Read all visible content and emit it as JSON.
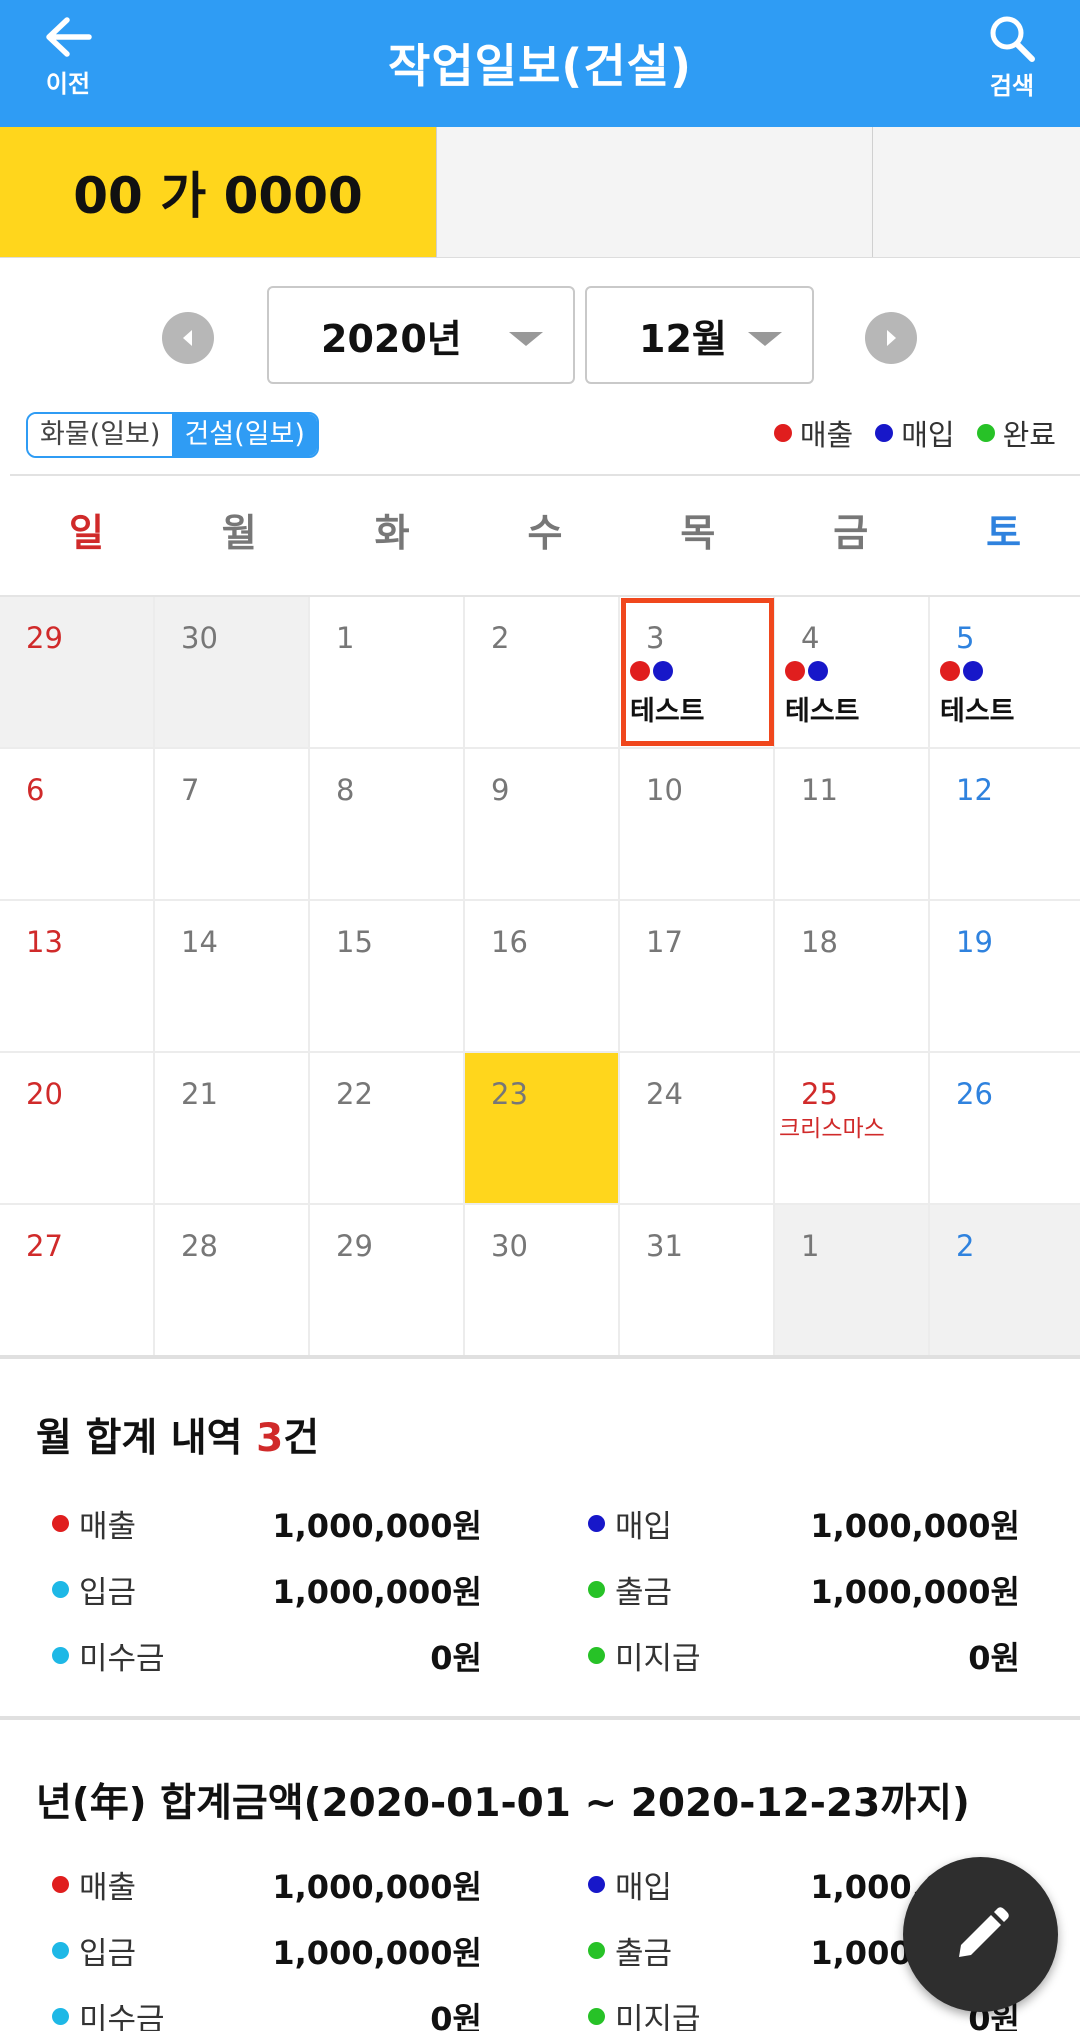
{
  "appbar": {
    "back_label": "이전",
    "title": "작업일보(건설)",
    "search_label": "검색"
  },
  "vehicles": {
    "active": "00 가 0000"
  },
  "selector": {
    "year": "2020년",
    "month": "12월"
  },
  "mode": {
    "option_cargo": "화물(일보)",
    "option_construction": "건설(일보)"
  },
  "legend": {
    "sales": "매출",
    "purchase": "매입",
    "complete": "완료",
    "colors": {
      "sales": "#e01e1e",
      "purchase": "#1717c9",
      "complete": "#27c227",
      "deposit": "#1eb8e6",
      "withdraw": "#27c227"
    }
  },
  "weekdays": [
    "일",
    "월",
    "화",
    "수",
    "목",
    "금",
    "토"
  ],
  "calendar": {
    "weeks": [
      [
        {
          "day": "29",
          "other": true
        },
        {
          "day": "30",
          "other": true
        },
        {
          "day": "1"
        },
        {
          "day": "2"
        },
        {
          "day": "3",
          "selected": true,
          "dots": [
            "sales",
            "purchase"
          ],
          "event": "테스트"
        },
        {
          "day": "4",
          "dots": [
            "sales",
            "purchase"
          ],
          "event": "테스트"
        },
        {
          "day": "5",
          "dots": [
            "sales",
            "purchase"
          ],
          "event": "테스트"
        }
      ],
      [
        {
          "day": "6"
        },
        {
          "day": "7"
        },
        {
          "day": "8"
        },
        {
          "day": "9"
        },
        {
          "day": "10"
        },
        {
          "day": "11"
        },
        {
          "day": "12"
        }
      ],
      [
        {
          "day": "13"
        },
        {
          "day": "14"
        },
        {
          "day": "15"
        },
        {
          "day": "16"
        },
        {
          "day": "17"
        },
        {
          "day": "18"
        },
        {
          "day": "19"
        }
      ],
      [
        {
          "day": "20"
        },
        {
          "day": "21"
        },
        {
          "day": "22"
        },
        {
          "day": "23",
          "today": true
        },
        {
          "day": "24"
        },
        {
          "day": "25",
          "holiday": "크리스마스"
        },
        {
          "day": "26"
        }
      ],
      [
        {
          "day": "27"
        },
        {
          "day": "28"
        },
        {
          "day": "29"
        },
        {
          "day": "30"
        },
        {
          "day": "31"
        },
        {
          "day": "1",
          "other": true
        },
        {
          "day": "2",
          "other": true
        }
      ]
    ]
  },
  "month_summary": {
    "title_prefix": "월 합계 내역 ",
    "count": "3",
    "title_suffix": "건",
    "sales_label": "매출",
    "sales_value": "1,000,000원",
    "purchase_label": "매입",
    "purchase_value": "1,000,000원",
    "deposit_label": "입금",
    "deposit_value": "1,000,000원",
    "withdraw_label": "출금",
    "withdraw_value": "1,000,000원",
    "receivable_label": "미수금",
    "receivable_value": "0원",
    "payable_label": "미지급",
    "payable_value": "0원"
  },
  "year_summary": {
    "title": "년(年) 합계금액(2020-01-01 ~ 2020-12-23까지)",
    "sales_label": "매출",
    "sales_value": "1,000,000원",
    "purchase_label": "매입",
    "purchase_value": "1,000,000원",
    "deposit_label": "입금",
    "deposit_value": "1,000,000원",
    "withdraw_label": "출금",
    "withdraw_value": "1,000,000원",
    "receivable_label": "미수금",
    "receivable_value": "0원",
    "payable_label": "미지급",
    "payable_value": "0원"
  }
}
